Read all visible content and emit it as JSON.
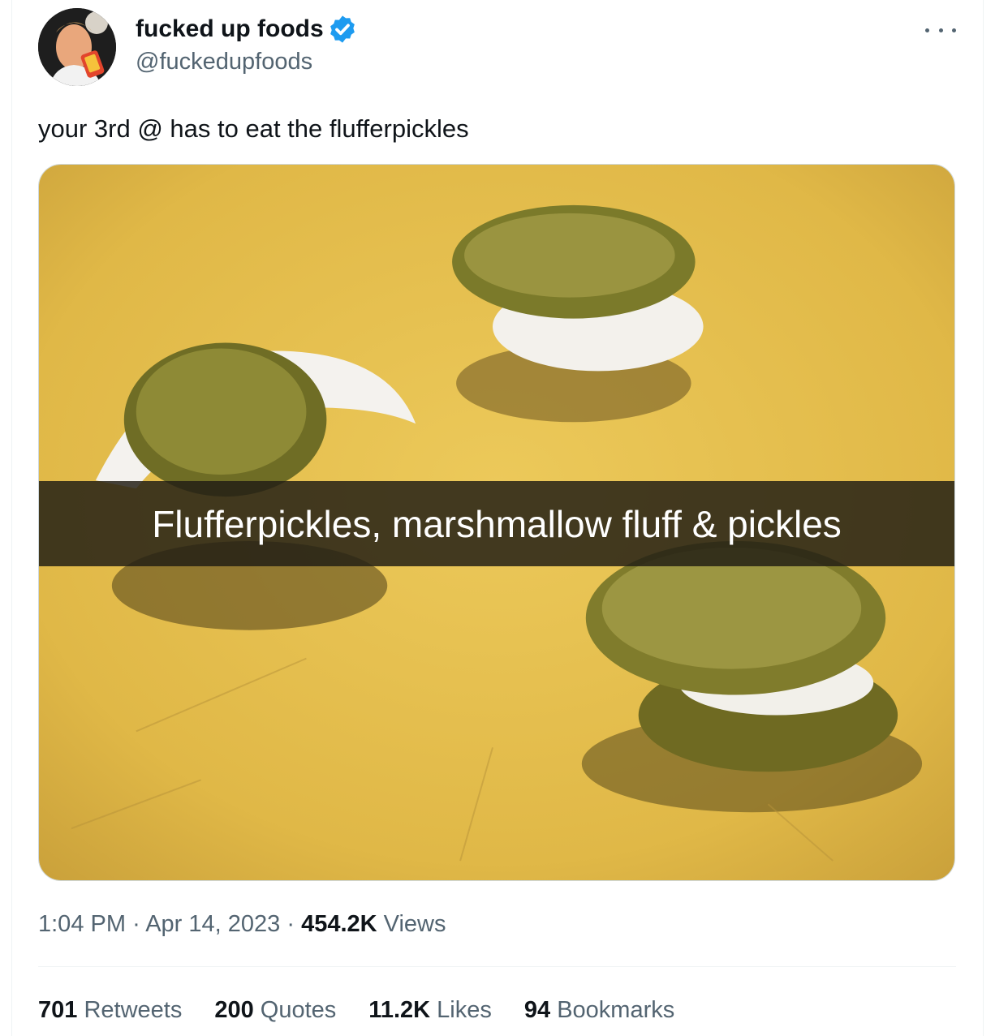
{
  "author": {
    "display_name": "fucked up foods",
    "handle": "@fuckedupfoods",
    "verified_icon": "verified-badge-icon",
    "badge_color": "#1d9bf0"
  },
  "tweet": {
    "text": "your 3rd @ has to eat the flufferpickles",
    "media_caption": "Flufferpickles, marshmallow fluff & pickles"
  },
  "meta": {
    "time": "1:04 PM",
    "separator": "·",
    "date": "Apr 14, 2023",
    "views_count": "454.2K",
    "views_label": "Views"
  },
  "stats": [
    {
      "count": "701",
      "label": "Retweets"
    },
    {
      "count": "200",
      "label": "Quotes"
    },
    {
      "count": "11.2K",
      "label": "Likes"
    },
    {
      "count": "94",
      "label": "Bookmarks"
    }
  ],
  "colors": {
    "text_primary": "#0f1419",
    "text_secondary": "#536471",
    "border": "#cfd9de",
    "plate": "#e8c24e"
  }
}
